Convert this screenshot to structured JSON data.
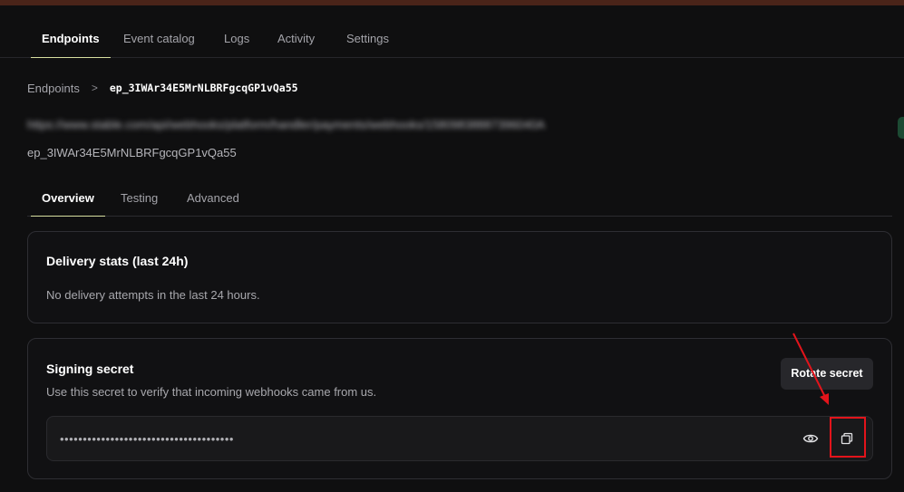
{
  "main_nav": {
    "tabs": [
      {
        "label": "Endpoints"
      },
      {
        "label": "Event catalog"
      },
      {
        "label": "Logs"
      },
      {
        "label": "Activity"
      },
      {
        "label": "Settings"
      }
    ],
    "active": "Endpoints"
  },
  "breadcrumb": {
    "parent": "Endpoints",
    "separator": ">",
    "current": "ep_3IWAr34E5MrNLBRFgcqGP1vQa55"
  },
  "endpoint": {
    "url_blurred": "https://www.stable.com/api/webhooks/platform/handler/payments/webhooks/15809838887396040A",
    "id": "ep_3IWAr34E5MrNLBRFgcqGP1vQa55"
  },
  "sub_tabs": [
    {
      "label": "Overview"
    },
    {
      "label": "Testing"
    },
    {
      "label": "Advanced"
    }
  ],
  "delivery_stats": {
    "title": "Delivery stats (last 24h)",
    "message": "No delivery attempts in the last 24 hours."
  },
  "signing_secret": {
    "title": "Signing secret",
    "description": "Use this secret to verify that incoming webhooks came from us.",
    "rotate_label": "Rotate secret",
    "masked_value": "••••••••••••••••••••••••••••••••••••••",
    "reveal_icon": "eye-icon",
    "copy_icon": "copy-icon"
  },
  "colors": {
    "background": "#0f0f10",
    "active_tab_underline": "#d8dfa0",
    "annotation_red": "#e3141b"
  }
}
